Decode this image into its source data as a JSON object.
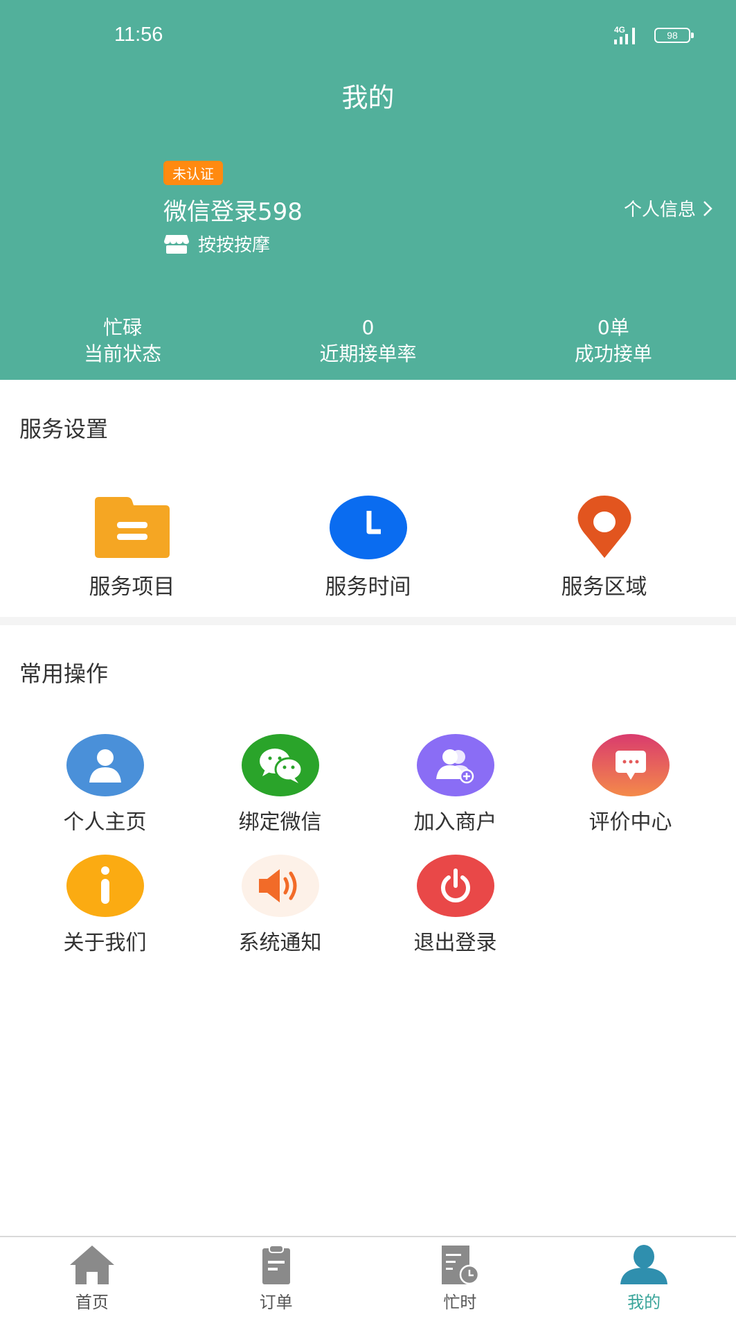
{
  "status_bar": {
    "time": "11:56",
    "network": "4G",
    "battery": "98"
  },
  "header": {
    "title": "我的",
    "badge": "未认证",
    "username": "微信登录598",
    "shop_name": "按按按摩",
    "profile_link": "个人信息",
    "stats": [
      {
        "value": "忙碌",
        "label": "当前状态"
      },
      {
        "value": "0",
        "label": "近期接单率"
      },
      {
        "value": "0单",
        "label": "成功接单"
      }
    ]
  },
  "service_settings": {
    "title": "服务设置",
    "items": [
      {
        "label": "服务项目",
        "icon": "folder-icon",
        "color": "#f5a623"
      },
      {
        "label": "服务时间",
        "icon": "clock-icon",
        "color": "#0a6cf0"
      },
      {
        "label": "服务区域",
        "icon": "location-pin-icon",
        "color": "#e2551f"
      }
    ]
  },
  "common_ops": {
    "title": "常用操作",
    "items": [
      {
        "label": "个人主页",
        "icon": "user-icon",
        "color": "#4a90d9"
      },
      {
        "label": "绑定微信",
        "icon": "wechat-icon",
        "color": "#2aa42a"
      },
      {
        "label": "加入商户",
        "icon": "add-user-icon",
        "color": "#8a6df5"
      },
      {
        "label": "评价中心",
        "icon": "message-icon",
        "color": "#e9486a"
      },
      {
        "label": "关于我们",
        "icon": "info-icon",
        "color": "#fbab12"
      },
      {
        "label": "系统通知",
        "icon": "speaker-icon",
        "color": "#f26b28"
      },
      {
        "label": "退出登录",
        "icon": "power-icon",
        "color": "#e94848"
      }
    ]
  },
  "tabbar": {
    "tabs": [
      {
        "label": "首页",
        "icon": "home-icon",
        "active": false
      },
      {
        "label": "订单",
        "icon": "clipboard-icon",
        "active": false
      },
      {
        "label": "忙时",
        "icon": "schedule-icon",
        "active": false
      },
      {
        "label": "我的",
        "icon": "profile-icon",
        "active": true
      }
    ],
    "active_color": "#2f8fae",
    "inactive_color": "#8a8a8a"
  }
}
